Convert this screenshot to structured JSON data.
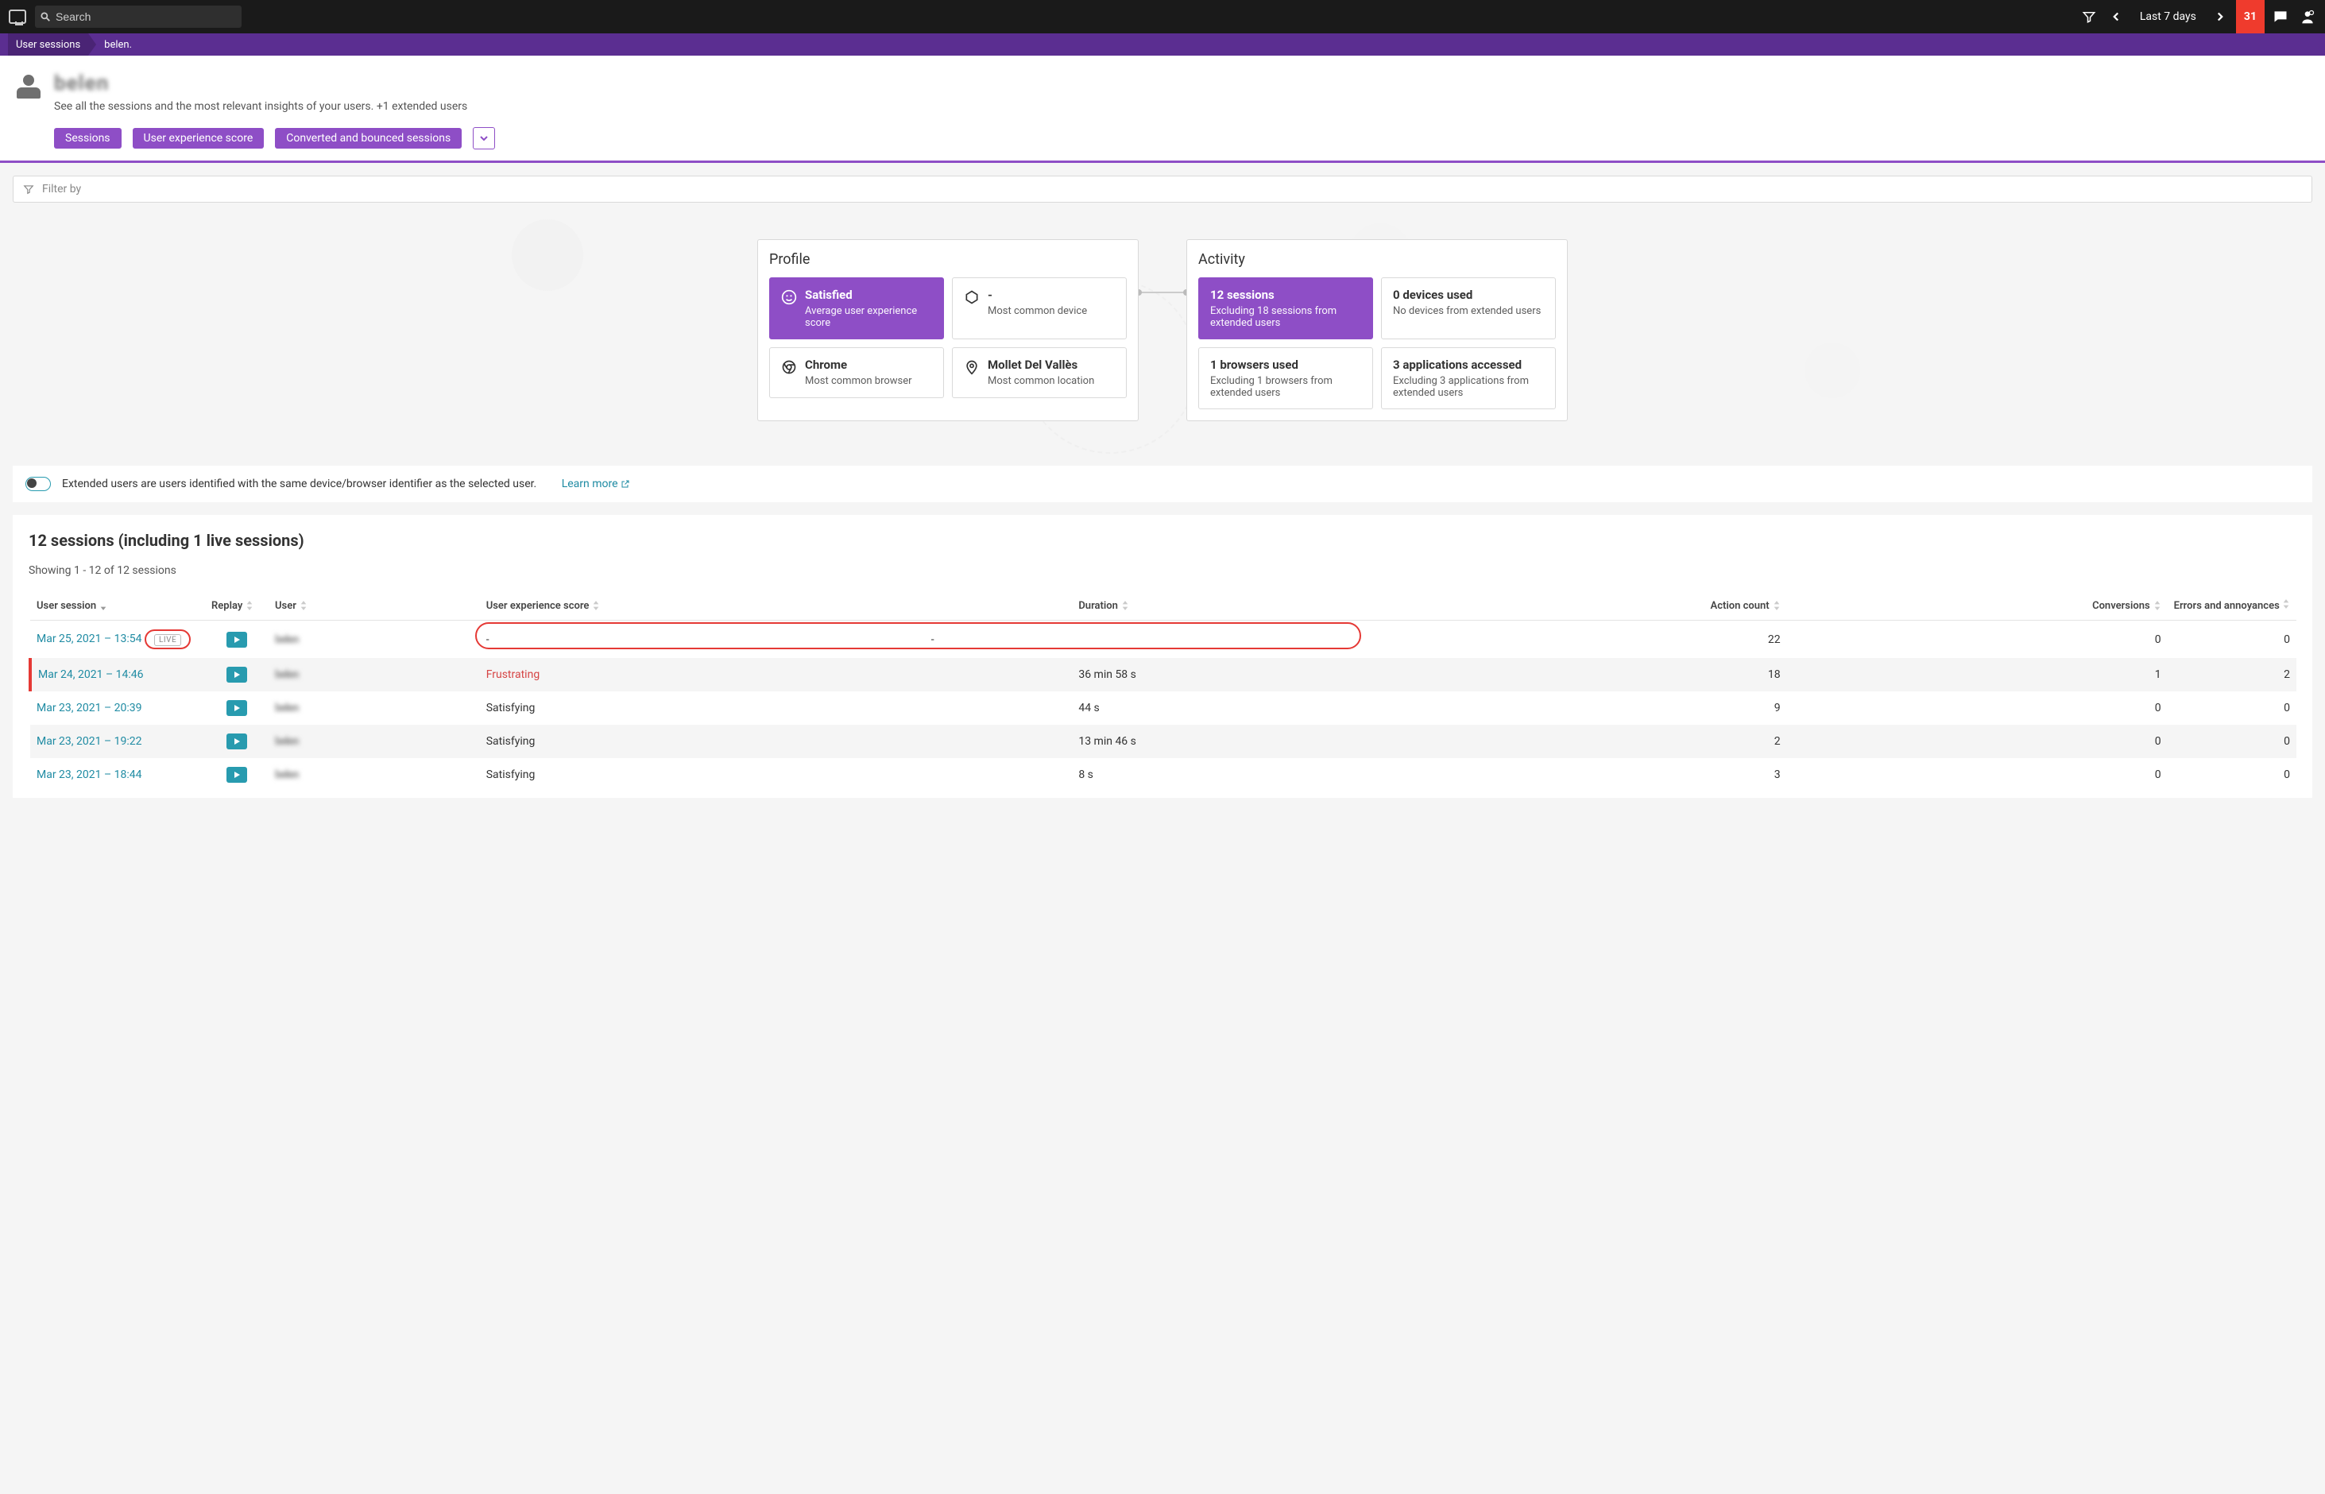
{
  "topbar": {
    "search_placeholder": "Search",
    "timeframe": "Last 7 days",
    "alert_count": "31"
  },
  "breadcrumb": {
    "root": "User sessions",
    "current": "belen."
  },
  "header": {
    "title": "belen",
    "subtitle": "See all the sessions and the most relevant insights of your users. +1 extended users",
    "chips": [
      "Sessions",
      "User experience score",
      "Converted and bounced sessions"
    ]
  },
  "filter_placeholder": "Filter by",
  "profile": {
    "title": "Profile",
    "tiles": [
      {
        "icon": "smile",
        "t": "Satisfied",
        "s": "Average user experience score",
        "active": true
      },
      {
        "icon": "hex",
        "t": "-",
        "s": "Most common device",
        "active": false
      },
      {
        "icon": "chrome",
        "t": "Chrome",
        "s": "Most common browser",
        "active": false
      },
      {
        "icon": "pin",
        "t": "Mollet Del Vallès",
        "s": "Most common location",
        "active": false
      }
    ]
  },
  "activity": {
    "title": "Activity",
    "tiles": [
      {
        "t": "12 sessions",
        "s": "Excluding 18 sessions from extended users",
        "active": true
      },
      {
        "t": "0 devices used",
        "s": "No devices from extended users",
        "active": false
      },
      {
        "t": "1 browsers used",
        "s": "Excluding 1 browsers from extended users",
        "active": false
      },
      {
        "t": "3 applications accessed",
        "s": "Excluding 3 applications from extended users",
        "active": false
      }
    ]
  },
  "extended": {
    "text": "Extended users are users identified with the same device/browser identifier as the selected user.",
    "learn_more": "Learn more"
  },
  "sessions": {
    "title": "12 sessions (including 1 live sessions)",
    "showing": "Showing 1 - 12 of 12 sessions",
    "columns": {
      "user_session": "User session",
      "replay": "Replay",
      "user": "User",
      "ux_score": "User experience score",
      "duration": "Duration",
      "action_count": "Action count",
      "conversions": "Conversions",
      "errors": "Errors and annoyances"
    },
    "rows": [
      {
        "ts": "Mar 25, 2021  –  13:54",
        "live": true,
        "user": "belen",
        "score": "-",
        "dur": "-",
        "actions": "22",
        "conv": "0",
        "err": "0",
        "danger": false,
        "highlight": true
      },
      {
        "ts": "Mar 24, 2021  –  14:46",
        "live": false,
        "user": "belen",
        "score": "Frustrating",
        "dur": "36 min 58 s",
        "actions": "18",
        "conv": "1",
        "err": "2",
        "danger": true
      },
      {
        "ts": "Mar 23, 2021  –  20:39",
        "live": false,
        "user": "belen",
        "score": "Satisfying",
        "dur": "44 s",
        "actions": "9",
        "conv": "0",
        "err": "0",
        "danger": false
      },
      {
        "ts": "Mar 23, 2021  –  19:22",
        "live": false,
        "user": "belen",
        "score": "Satisfying",
        "dur": "13 min 46 s",
        "actions": "2",
        "conv": "0",
        "err": "0",
        "danger": false
      },
      {
        "ts": "Mar 23, 2021  –  18:44",
        "live": false,
        "user": "belen",
        "score": "Satisfying",
        "dur": "8 s",
        "actions": "3",
        "conv": "0",
        "err": "0",
        "danger": false
      }
    ],
    "live_label": "LIVE"
  }
}
